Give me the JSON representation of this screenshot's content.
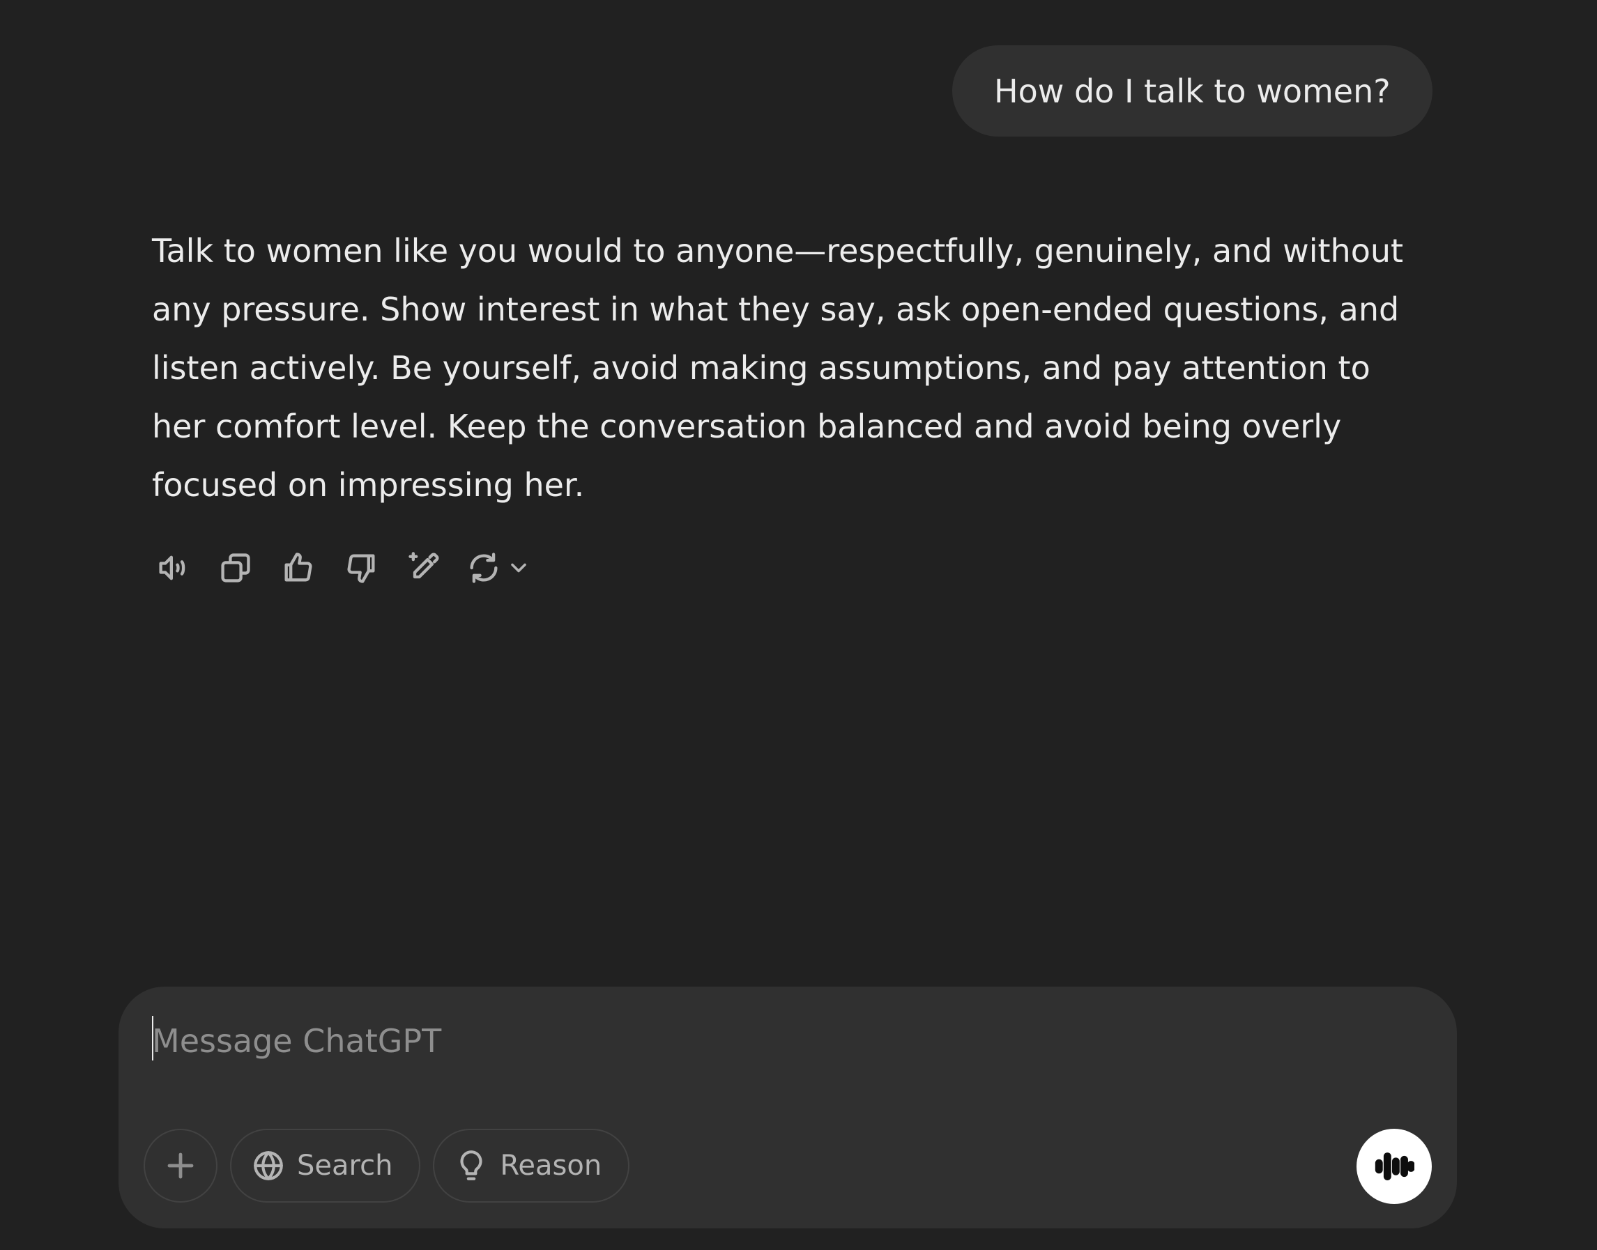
{
  "conversation": {
    "user_message": "How do I talk to women?",
    "assistant_message": "Talk to women like you would to anyone—respectfully, genuinely, and without any pressure. Show interest in what they say, ask open-ended questions, and listen actively. Be yourself, avoid making assumptions, and pay attention to her comfort level. Keep the conversation balanced and avoid being overly focused on impressing her."
  },
  "message_actions": [
    {
      "icon": "read-aloud-icon"
    },
    {
      "icon": "copy-icon"
    },
    {
      "icon": "thumbs-up-icon"
    },
    {
      "icon": "thumbs-down-icon"
    },
    {
      "icon": "edit-in-canvas-icon"
    },
    {
      "icon": "regenerate-icon"
    }
  ],
  "composer": {
    "placeholder": "Message ChatGPT",
    "value": "",
    "search_label": "Search",
    "reason_label": "Reason",
    "plus_icon": "plus-icon",
    "search_icon": "globe-icon",
    "reason_icon": "lightbulb-icon",
    "voice_icon": "voice-mode-icon"
  },
  "colors": {
    "background": "#212121",
    "bubble": "#303030",
    "text": "#ececec",
    "muted": "#b4b4b4",
    "voice_button": "#ffffff"
  }
}
